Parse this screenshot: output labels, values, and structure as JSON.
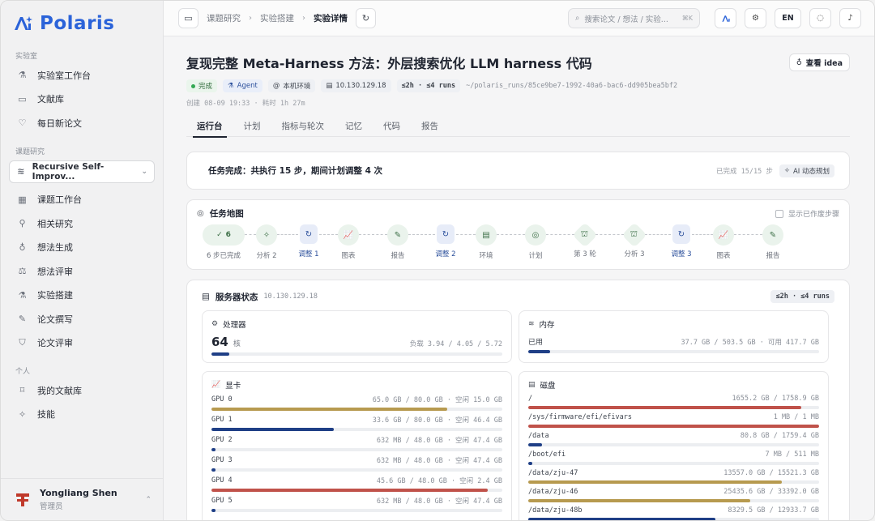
{
  "brand": {
    "name": "Polaris",
    "accent": "#2b63d9"
  },
  "sidebar": {
    "section_lab": "实验室",
    "lab_items": [
      {
        "label": "实验室工作台",
        "icon": "flask-icon"
      },
      {
        "label": "文献库",
        "icon": "book-icon"
      },
      {
        "label": "每日新论文",
        "icon": "heart-icon"
      }
    ],
    "section_topic": "课题研究",
    "project": "Recursive Self-Improv...",
    "topic_items": [
      {
        "label": "课题工作台",
        "icon": "grid-icon"
      },
      {
        "label": "相关研究",
        "icon": "pin-icon"
      },
      {
        "label": "想法生成",
        "icon": "bulb-icon"
      },
      {
        "label": "想法评审",
        "icon": "scale-icon"
      },
      {
        "label": "实验搭建",
        "icon": "flask-icon"
      },
      {
        "label": "论文撰写",
        "icon": "pen-icon"
      },
      {
        "label": "论文评审",
        "icon": "shield-icon"
      }
    ],
    "section_personal": "个人",
    "personal_items": [
      {
        "label": "我的文献库",
        "icon": "bookmark-icon"
      },
      {
        "label": "技能",
        "icon": "sparkle-icon"
      }
    ],
    "user": {
      "name": "Yongliang Shen",
      "role": "管理员"
    }
  },
  "topbar": {
    "breadcrumb": [
      "课题研究",
      "实验搭建",
      "实验详情"
    ],
    "search_placeholder": "搜索论文 / 想法 / 实验...",
    "search_shortcut": "⌘K",
    "lang": "EN"
  },
  "page": {
    "title": "复现完整 Meta-Harness 方法：外层搜索优化 LLM harness 代码",
    "idea_button": "查看 idea",
    "tags": {
      "status": "完成",
      "agent": "Agent",
      "env": "本机环境",
      "ip": "10.130.129.18",
      "quota": "≤2h · ≤4 runs"
    },
    "path": "~/polaris_runs/85ce9be7-1992-40a6-bac6-dd905bea5bf2",
    "created": "创建 08-09 19:33 · 耗时 1h 27m",
    "tabs": [
      "运行台",
      "计划",
      "指标与轮次",
      "记忆",
      "代码",
      "报告"
    ]
  },
  "status": {
    "text": "任务完成：共执行 15 步，期间计划调整 4 次",
    "progress": "已完成 15/15 步",
    "ai_label": "AI 动态规划"
  },
  "task_map": {
    "title": "任务地图",
    "show_discarded": "显示已作废步骤",
    "steps": [
      {
        "kind": "wide",
        "icon": "check-icon",
        "glyph": "✓",
        "count": "6",
        "label": "6 步已完成"
      },
      {
        "kind": "normal",
        "icon": "sparkle-icon",
        "glyph": "✧",
        "label": "分析 2"
      },
      {
        "kind": "adjust",
        "icon": "refresh-icon",
        "glyph": "↻",
        "label": "调整 1"
      },
      {
        "kind": "normal",
        "icon": "chart-icon",
        "glyph": "📈",
        "label": "图表"
      },
      {
        "kind": "normal",
        "icon": "pen-icon",
        "glyph": "✎",
        "label": "报告"
      },
      {
        "kind": "adjust",
        "icon": "refresh-icon",
        "glyph": "↻",
        "label": "调整 2"
      },
      {
        "kind": "normal",
        "icon": "server-icon",
        "glyph": "▤",
        "label": "环境"
      },
      {
        "kind": "normal",
        "icon": "compass-icon",
        "glyph": "◎",
        "label": "计划"
      },
      {
        "kind": "hex",
        "icon": "lab-icon",
        "glyph": "⛫",
        "label": "第 3 轮"
      },
      {
        "kind": "hex",
        "icon": "lab-icon",
        "glyph": "⛫",
        "label": "分析 3"
      },
      {
        "kind": "adjust",
        "icon": "refresh-icon",
        "glyph": "↻",
        "label": "调整 3"
      },
      {
        "kind": "normal",
        "icon": "chart-icon",
        "glyph": "📈",
        "label": "图表"
      },
      {
        "kind": "normal",
        "icon": "pen-icon",
        "glyph": "✎",
        "label": "报告"
      }
    ]
  },
  "server": {
    "title": "服务器状态",
    "ip": "10.130.129.18",
    "quota": "≤2h · ≤4 runs",
    "cpu": {
      "title": "处理器",
      "cores": "64",
      "unit": "核",
      "load": "负载 3.94 / 4.05 / 5.72",
      "usage": 0.06,
      "color": "#1f3f86"
    },
    "memory": {
      "title": "内存",
      "used_label": "已用",
      "detail": "37.7 GB / 503.5 GB · 可用 417.7 GB",
      "usage": 0.075,
      "color": "#1f3f86"
    },
    "gpu": {
      "title": "显卡",
      "items": [
        {
          "name": "GPU 0",
          "detail": "65.0 GB / 80.0 GB · 空闲 15.0 GB",
          "usage": 0.81,
          "color": "#b79a4f"
        },
        {
          "name": "GPU 1",
          "detail": "33.6 GB / 80.0 GB · 空闲 46.4 GB",
          "usage": 0.42,
          "color": "#1f3f86"
        },
        {
          "name": "GPU 2",
          "detail": "632 MB / 48.0 GB · 空闲 47.4 GB",
          "usage": 0.013,
          "color": "#1f3f86"
        },
        {
          "name": "GPU 3",
          "detail": "632 MB / 48.0 GB · 空闲 47.4 GB",
          "usage": 0.013,
          "color": "#1f3f86"
        },
        {
          "name": "GPU 4",
          "detail": "45.6 GB / 48.0 GB · 空闲 2.4 GB",
          "usage": 0.95,
          "color": "#c0524a"
        },
        {
          "name": "GPU 5",
          "detail": "632 MB / 48.0 GB · 空闲 47.4 GB",
          "usage": 0.013,
          "color": "#1f3f86"
        }
      ]
    },
    "disk": {
      "title": "磁盘",
      "items": [
        {
          "name": "/",
          "detail": "1655.2 GB / 1758.9 GB",
          "usage": 0.94,
          "color": "#c0524a"
        },
        {
          "name": "/sys/firmware/efi/efivars",
          "detail": "1 MB / 1 MB",
          "usage": 1.0,
          "color": "#c0524a"
        },
        {
          "name": "/data",
          "detail": "80.8 GB / 1759.4 GB",
          "usage": 0.046,
          "color": "#1f3f86"
        },
        {
          "name": "/boot/efi",
          "detail": "7 MB / 511 MB",
          "usage": 0.014,
          "color": "#1f3f86"
        },
        {
          "name": "/data/zju-47",
          "detail": "13557.0 GB / 15521.3 GB",
          "usage": 0.873,
          "color": "#b79a4f"
        },
        {
          "name": "/data/zju-46",
          "detail": "25435.6 GB / 33392.0 GB",
          "usage": 0.762,
          "color": "#b79a4f"
        },
        {
          "name": "/data/zju-48b",
          "detail": "8329.5 GB / 12933.7 GB",
          "usage": 0.644,
          "color": "#1f3f86"
        }
      ]
    }
  }
}
